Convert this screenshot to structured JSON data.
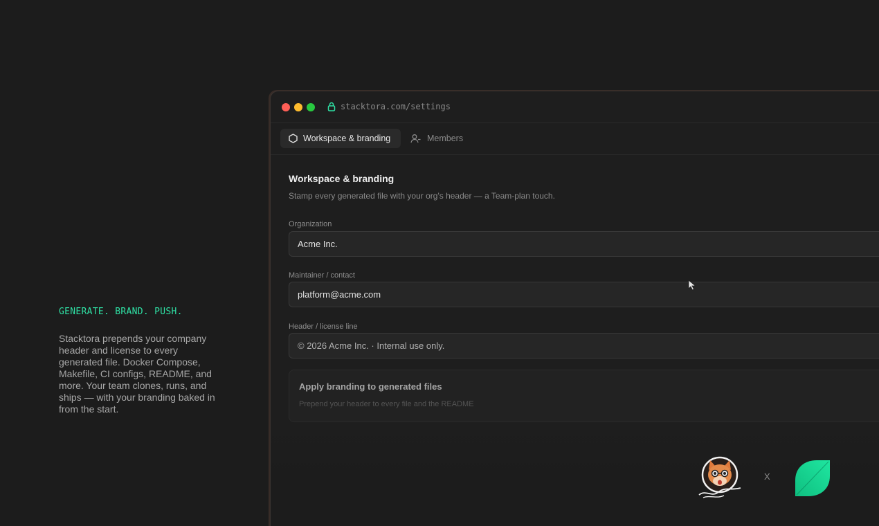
{
  "promo": {
    "tagline": "GENERATE. BRAND. PUSH.",
    "blurb": "Stacktora prepends your company header and license to every generated file. Docker Compose, Makefile, CI configs, README, and more. Your team clones, runs, and ships — with your branding baked in from the start."
  },
  "browser": {
    "url": "stacktora.com/settings",
    "traffic_lights": [
      "close",
      "minimize",
      "zoom"
    ]
  },
  "tabs": [
    {
      "label": "Workspace & branding",
      "icon": "hexagon-icon",
      "active": true
    },
    {
      "label": "Members",
      "icon": "users-icon",
      "active": false
    }
  ],
  "settings": {
    "title": "Workspace & branding",
    "subtitle": "Stamp every generated file with your org's header — a Team-plan touch.",
    "fields": [
      {
        "label": "Organization",
        "value": "Acme Inc."
      },
      {
        "label": "Maintainer / contact",
        "value": "platform@acme.com"
      },
      {
        "label": "Header / license line",
        "value": "© 2026 Acme Inc. · Internal use only."
      }
    ],
    "branding_card": {
      "title": "Apply branding to generated files",
      "subtitle": "Prepend your header to every file and the README"
    }
  },
  "footer": {
    "separator": "X",
    "logos": [
      "product-hunt-cat-logo",
      "stacktora-leaf-logo"
    ]
  },
  "colors": {
    "accent": "#2fe0a4",
    "background": "#1c1c1c",
    "leaf_green": "#13d692"
  }
}
